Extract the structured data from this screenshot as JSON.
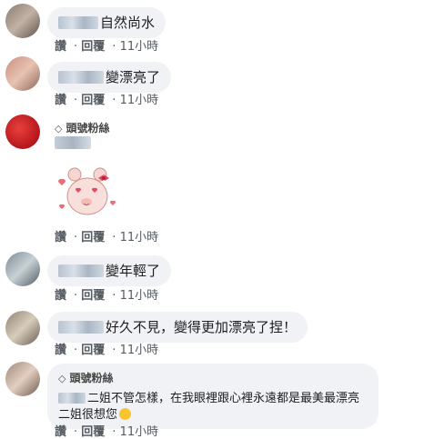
{
  "actions": {
    "like": "讚",
    "reply": "回覆",
    "time": "11小時"
  },
  "badge_label": "頭號粉絲",
  "badge_icon": "diamond-icon",
  "comments": [
    {
      "text": "自然尚水"
    },
    {
      "text": "變漂亮了"
    },
    {
      "text": ""
    },
    {
      "text": "變年輕了"
    },
    {
      "text": "好久不見，變得更加漂亮了捏！"
    },
    {
      "text_line1": "二姐不管怎樣，在我眼裡跟心裡永遠都是最美最漂亮",
      "text_line2": "二姐很想您"
    }
  ],
  "colors": {
    "bubble": "#f0f2f5",
    "action": "#555b62"
  }
}
